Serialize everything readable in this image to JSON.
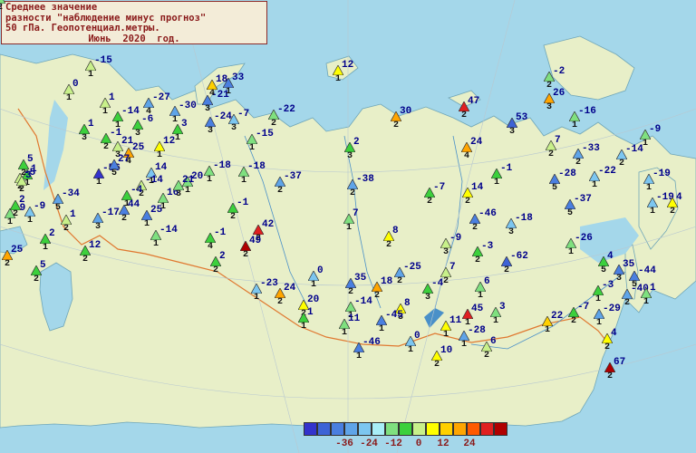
{
  "title": {
    "line1": "Среднее значение",
    "line2": "разности \"наблюдение минус прогноз\"",
    "line3": "50 гПа. Геопотенциал.метры.",
    "line4": "Июнь  2020  год."
  },
  "legend": {
    "colors": [
      "#3333cc",
      "#3d63d6",
      "#4a7fe0",
      "#5fa4e8",
      "#7cc6f0",
      "#a8eef7",
      "#7fe07f",
      "#3cd03c",
      "#c8f08a",
      "#ffff00",
      "#ffd000",
      "#ffa500",
      "#ff5a00",
      "#e02020",
      "#b00000"
    ],
    "labels": [
      "-36",
      "-24",
      "-12",
      "0",
      "12",
      "24"
    ]
  },
  "stations": [
    {
      "v": "-15",
      "n": "1",
      "c": "#c8f08a"
    },
    {
      "v": "0",
      "n": "1",
      "c": "#c8f08a"
    },
    {
      "v": "1",
      "n": "1",
      "c": "#c8f08a"
    },
    {
      "v": "-27",
      "n": "4",
      "c": "#5fa4e8"
    },
    {
      "v": "-14",
      "n": "1",
      "c": "#3cd03c"
    },
    {
      "v": "-6",
      "n": "3",
      "c": "#3cd03c"
    },
    {
      "v": "-30",
      "n": "1",
      "c": "#5fa4e8"
    },
    {
      "v": "-21",
      "n": "3",
      "c": "#4a7fe0"
    },
    {
      "v": "18",
      "n": "4",
      "c": "#ffd000"
    },
    {
      "v": "33",
      "n": "1",
      "c": "#4a7fe0"
    },
    {
      "v": "12",
      "n": "1",
      "c": "#ffff00"
    },
    {
      "v": "-24",
      "n": "3",
      "c": "#4a7fe0"
    },
    {
      "v": "-7",
      "n": "3",
      "c": "#7cc6f0"
    },
    {
      "v": "-22",
      "n": "2",
      "c": "#7fe07f"
    },
    {
      "v": "30",
      "n": "2",
      "c": "#ffa500"
    },
    {
      "v": "47",
      "n": "2",
      "c": "#e02020"
    },
    {
      "v": "-2",
      "n": "2",
      "c": "#7fe07f"
    },
    {
      "v": "26",
      "n": "3",
      "c": "#ffa500"
    },
    {
      "v": "-16",
      "n": "1",
      "c": "#7fe07f"
    },
    {
      "v": "53",
      "n": "3",
      "c": "#3d63d6"
    },
    {
      "v": "-9",
      "n": "1",
      "c": "#7fe07f"
    },
    {
      "v": "1",
      "n": "3",
      "c": "#3cd03c"
    },
    {
      "v": "-1",
      "n": "2",
      "c": "#3cd03c"
    },
    {
      "v": "3",
      "n": "1",
      "c": "#3cd03c"
    },
    {
      "v": "-15",
      "n": "1",
      "c": "#7fe07f"
    },
    {
      "v": "21",
      "n": "3",
      "c": "#c8f08a"
    },
    {
      "v": "25",
      "n": "4",
      "c": "#ffa500"
    },
    {
      "v": "12",
      "n": "1",
      "c": "#ffff00"
    },
    {
      "v": "2",
      "n": "3",
      "c": "#3cd03c"
    },
    {
      "v": "-14",
      "n": "2",
      "c": "#7cc6f0"
    },
    {
      "v": "-18",
      "n": "1",
      "c": "#7fe07f"
    },
    {
      "v": "24",
      "n": "4",
      "c": "#ffa500"
    },
    {
      "v": "7",
      "n": "2",
      "c": "#c8f08a"
    },
    {
      "v": "-33",
      "n": "2",
      "c": "#5fa4e8"
    },
    {
      "v": "-19",
      "n": "1",
      "c": "#7cc6f0"
    },
    {
      "v": "-37",
      "n": "2",
      "c": "#5fa4e8"
    },
    {
      "v": "-1",
      "n": "1",
      "c": "#3cd03c"
    },
    {
      "v": "1",
      "n": "1",
      "c": "#3cd03c"
    },
    {
      "v": "-56",
      "n": "1",
      "c": "#3333cc"
    },
    {
      "v": "27",
      "n": "5",
      "c": "#4a7fe0"
    },
    {
      "v": "14",
      "n": "1",
      "c": "#7cc6f0"
    },
    {
      "v": "20",
      "n": "1",
      "c": "#7fe07f"
    },
    {
      "v": "-18",
      "n": "1",
      "c": "#7fe07f"
    },
    {
      "v": "-14",
      "n": "2",
      "c": "#c8f08a"
    },
    {
      "v": "-38",
      "n": "2",
      "c": "#5fa4e8"
    },
    {
      "v": "-28",
      "n": "5",
      "c": "#4a7fe0"
    },
    {
      "v": "-22",
      "n": "1",
      "c": "#7cc6f0"
    },
    {
      "v": "-9",
      "n": "1",
      "c": "#7cc6f0"
    },
    {
      "v": "-19",
      "n": "1",
      "c": "#7cc6f0"
    },
    {
      "v": "-34",
      "n": "5",
      "c": "#5fa4e8"
    },
    {
      "v": "-4",
      "n": "1",
      "c": "#3cd03c"
    },
    {
      "v": "16",
      "n": "1",
      "c": "#7fe07f"
    },
    {
      "v": "21",
      "n": "3",
      "c": "#7fe07f"
    },
    {
      "v": "-7",
      "n": "2",
      "c": "#3cd03c"
    },
    {
      "v": "14",
      "n": "2",
      "c": "#ffff00"
    },
    {
      "v": "-37",
      "n": "5",
      "c": "#4a7fe0"
    },
    {
      "v": "4",
      "n": "2",
      "c": "#ffff00"
    },
    {
      "v": "-9",
      "n": "1",
      "c": "#7fe07f"
    },
    {
      "v": "-17",
      "n": "3",
      "c": "#5fa4e8"
    },
    {
      "v": "44",
      "n": "2",
      "c": "#4a7fe0"
    },
    {
      "v": "25",
      "n": "1",
      "c": "#4a7fe0"
    },
    {
      "v": "-1",
      "n": "2",
      "c": "#3cd03c"
    },
    {
      "v": "7",
      "n": "1",
      "c": "#7fe07f"
    },
    {
      "v": "-46",
      "n": "2",
      "c": "#4a7fe0"
    },
    {
      "v": "-18",
      "n": "3",
      "c": "#7cc6f0"
    },
    {
      "v": "2",
      "n": "1",
      "c": "#3cd03c"
    },
    {
      "v": "12",
      "n": "2",
      "c": "#3cd03c"
    },
    {
      "v": "-14",
      "n": "1",
      "c": "#7fe07f"
    },
    {
      "v": "-1",
      "n": "4",
      "c": "#3cd03c"
    },
    {
      "v": "42",
      "n": "2",
      "c": "#e02020"
    },
    {
      "v": "49",
      "n": "2",
      "c": "#b00000"
    },
    {
      "v": "8",
      "n": "2",
      "c": "#ffff00"
    },
    {
      "v": "-9",
      "n": "3",
      "c": "#c8f08a"
    },
    {
      "v": "-3",
      "n": "2",
      "c": "#3cd03c"
    },
    {
      "v": "-62",
      "n": "2",
      "c": "#3d63d6"
    },
    {
      "v": "-26",
      "n": "1",
      "c": "#7fe07f"
    },
    {
      "v": "5",
      "n": "2",
      "c": "#3cd03c"
    },
    {
      "v": "2",
      "n": "2",
      "c": "#3cd03c"
    },
    {
      "v": "-25",
      "n": "2",
      "c": "#5fa4e8"
    },
    {
      "v": "7",
      "n": "2",
      "c": "#c8f08a"
    },
    {
      "v": "4",
      "n": "5",
      "c": "#3cd03c"
    },
    {
      "v": "35",
      "n": "3",
      "c": "#4a7fe0"
    },
    {
      "v": "-44",
      "n": "5",
      "c": "#4a7fe0"
    },
    {
      "v": "0",
      "n": "1",
      "c": "#7cc6f0"
    },
    {
      "v": "35",
      "n": "2",
      "c": "#4a7fe0"
    },
    {
      "v": "18",
      "n": "2",
      "c": "#ffa500"
    },
    {
      "v": "-4",
      "n": "3",
      "c": "#3cd03c"
    },
    {
      "v": "6",
      "n": "1",
      "c": "#7fe07f"
    },
    {
      "v": "-3",
      "n": "1",
      "c": "#3cd03c"
    },
    {
      "v": "-40",
      "n": "2",
      "c": "#5fa4e8"
    },
    {
      "v": "1",
      "n": "1",
      "c": "#7fe07f"
    },
    {
      "v": "-23",
      "n": "1",
      "c": "#7cc6f0"
    },
    {
      "v": "24",
      "n": "2",
      "c": "#ffa500"
    },
    {
      "v": "20",
      "n": "2",
      "c": "#ffff00"
    },
    {
      "v": "-14",
      "n": "1",
      "c": "#7fe07f"
    },
    {
      "v": "8",
      "n": "3",
      "c": "#ffff00"
    },
    {
      "v": "45",
      "n": "1",
      "c": "#e02020"
    },
    {
      "v": "3",
      "n": "1",
      "c": "#7fe07f"
    },
    {
      "v": "22",
      "n": "1",
      "c": "#ffd000"
    },
    {
      "v": "-7",
      "n": "2",
      "c": "#3cd03c"
    },
    {
      "v": "-29",
      "n": "1",
      "c": "#5fa4e8"
    },
    {
      "v": "1",
      "n": "1",
      "c": "#3cd03c"
    },
    {
      "v": "11",
      "n": "1",
      "c": "#7fe07f"
    },
    {
      "v": "-45",
      "n": "1",
      "c": "#4a7fe0"
    },
    {
      "v": "11",
      "n": "1",
      "c": "#ffff00"
    },
    {
      "v": "-28",
      "n": "1",
      "c": "#5fa4e8"
    },
    {
      "v": "4",
      "n": "2",
      "c": "#ffff00"
    },
    {
      "v": "-46",
      "n": "1",
      "c": "#4a7fe0"
    },
    {
      "v": "0",
      "n": "1",
      "c": "#7cc6f0"
    },
    {
      "v": "10",
      "n": "2",
      "c": "#ffff00"
    },
    {
      "v": "6",
      "n": "2",
      "c": "#c8f08a"
    },
    {
      "v": "67",
      "n": "2",
      "c": "#b00000"
    },
    {
      "v": "25",
      "n": "2",
      "c": "#ffa500"
    },
    {
      "v": "5",
      "n": "2",
      "c": "#3cd03c"
    },
    {
      "v": "-5",
      "n": "2",
      "c": "#c8f08a"
    },
    {
      "v": "3",
      "n": "2",
      "c": "#c8f08a"
    },
    {
      "v": "2",
      "n": "2",
      "c": "#3cd03c"
    },
    {
      "v": "1",
      "n": "2",
      "c": "#c8f08a"
    },
    {
      "v": "12",
      "n": "2",
      "c": "#7fe07f"
    }
  ]
}
